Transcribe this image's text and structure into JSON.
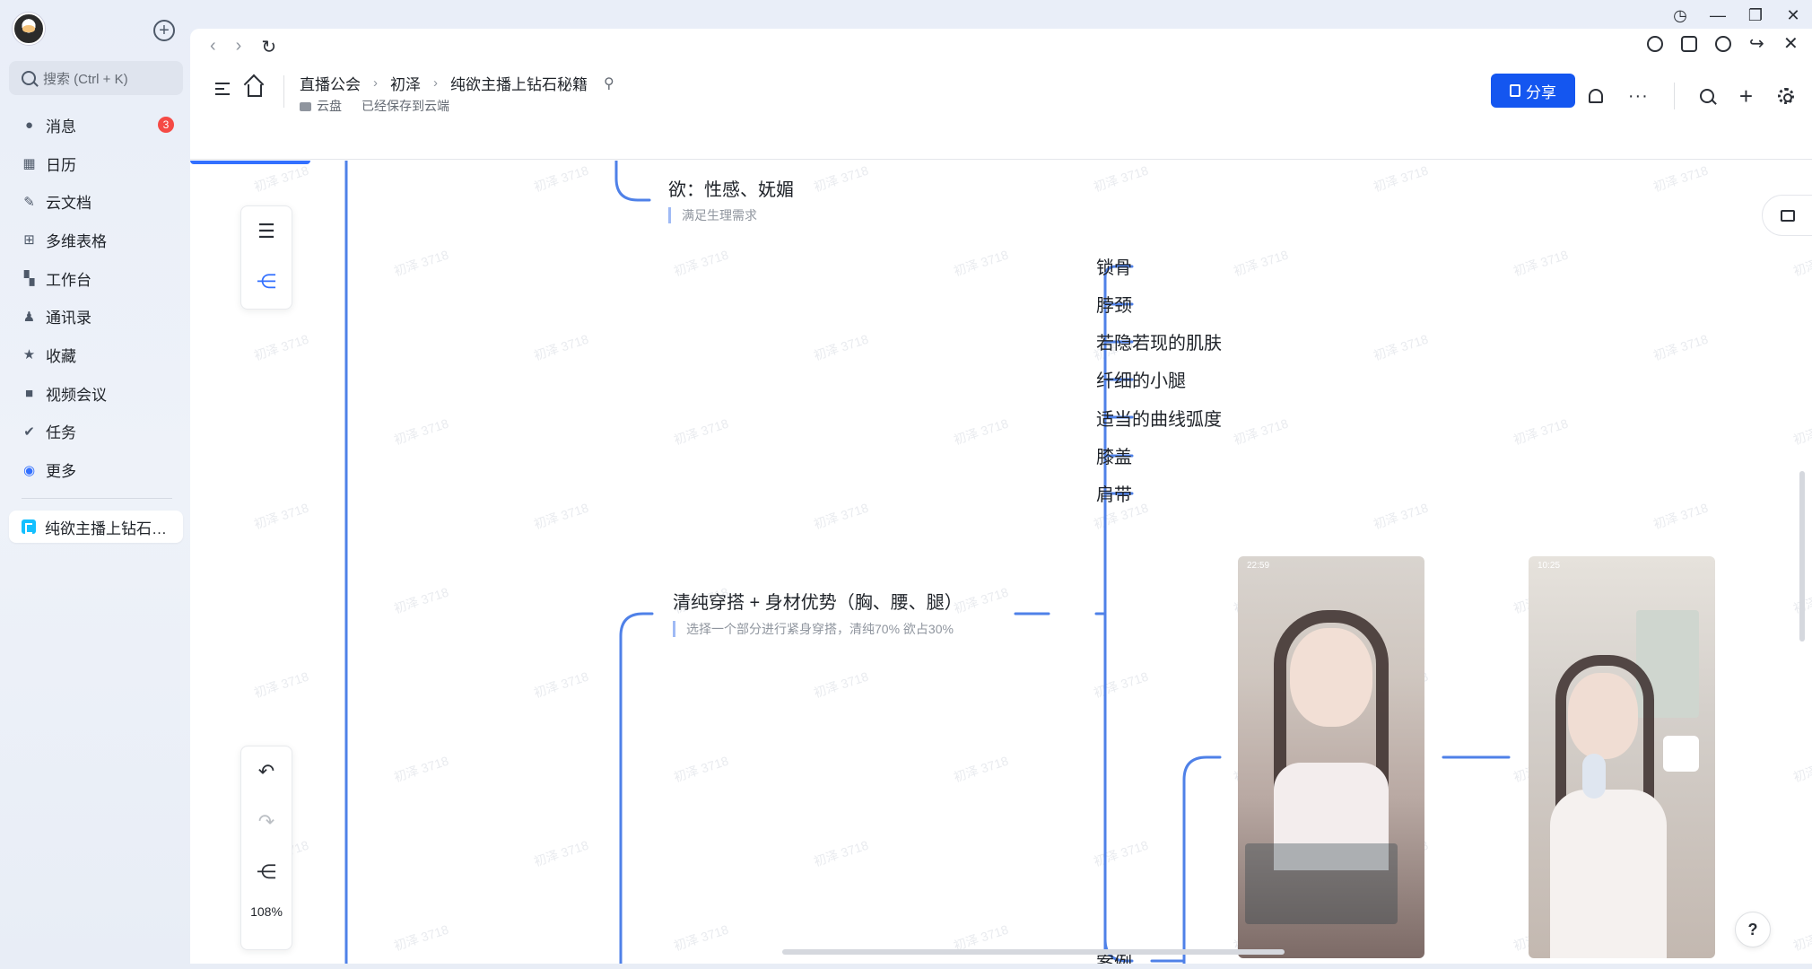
{
  "sidebar": {
    "search_placeholder": "搜索 (Ctrl + K)",
    "items": [
      {
        "label": "消息",
        "icon": "message-icon",
        "badge": "3"
      },
      {
        "label": "日历",
        "icon": "calendar-icon"
      },
      {
        "label": "云文档",
        "icon": "cloud-doc-icon"
      },
      {
        "label": "多维表格",
        "icon": "bitable-icon"
      },
      {
        "label": "工作台",
        "icon": "workplace-icon"
      },
      {
        "label": "通讯录",
        "icon": "contacts-icon"
      },
      {
        "label": "收藏",
        "icon": "star-icon"
      },
      {
        "label": "视频会议",
        "icon": "video-icon"
      },
      {
        "label": "任务",
        "icon": "task-icon"
      },
      {
        "label": "更多",
        "icon": "more-icon"
      }
    ],
    "open_doc": "纯欲主播上钻石…"
  },
  "header": {
    "breadcrumbs": [
      "直播公会",
      "初泽",
      "纯欲主播上钻石秘籍"
    ],
    "location": "云盘",
    "save_status": "已经保存到云端",
    "share_label": "分享"
  },
  "canvas": {
    "zoom": "108%",
    "watermark": "初泽 3718",
    "nodes": {
      "desire": "欲：性感、妩媚",
      "desire_note": "满足生理需求",
      "parts": [
        "锁骨",
        "脖颈",
        "若隐若现的肌肤",
        "纤细的小腿",
        "适当的曲线弧度",
        "膝盖",
        "肩带"
      ],
      "outfit": "清纯穿搭 + 身材优势（胸、腰、腿）",
      "outfit_note": "选择一个部分进行紧身穿搭，清纯70% 欲占30%",
      "case": "案例"
    },
    "phones": [
      {
        "time": "22:59"
      },
      {
        "time": "10:25"
      }
    ]
  },
  "colors": {
    "accent": "#1456f0",
    "line": "#3370ff",
    "badge": "#f54a45"
  }
}
